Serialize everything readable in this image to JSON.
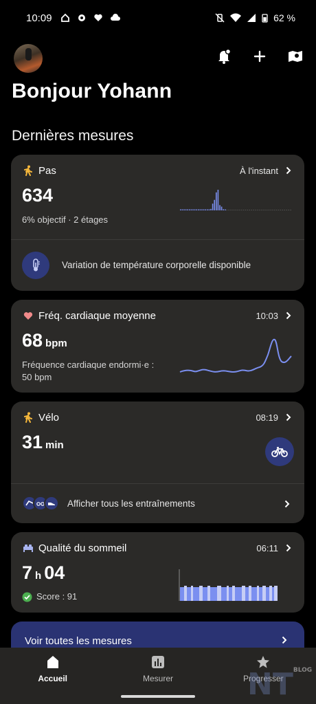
{
  "status_bar": {
    "time": "10:09",
    "battery": "62 %"
  },
  "header": {
    "greeting": "Bonjour Yohann"
  },
  "section_title": "Dernières mesures",
  "cards": {
    "steps": {
      "title": "Pas",
      "time": "À l'instant",
      "value": "634",
      "goal": "6% objectif",
      "floors": "· 2 étages",
      "chart_values": [
        1,
        1,
        1,
        1,
        1,
        1,
        1,
        1,
        1,
        1,
        1,
        1,
        1,
        1,
        1,
        2,
        1,
        4,
        18,
        28,
        48,
        55,
        14,
        10,
        3,
        1
      ]
    },
    "temperature": {
      "text": "Variation de température corporelle disponible"
    },
    "heart": {
      "title": "Fréq. cardiaque moyenne",
      "time": "10:03",
      "value": "68",
      "unit": "bpm",
      "sub1": "Fréquence cardiaque endormi·e :",
      "sub2": "50 bpm"
    },
    "bike": {
      "title": "Vélo",
      "time": "08:19",
      "value": "31",
      "unit": "min",
      "all_workouts": "Afficher tous les entraînements"
    },
    "sleep": {
      "title": "Qualité du sommeil",
      "time": "06:11",
      "hours": "7",
      "h_unit": "h",
      "minutes": "04",
      "score": "Score : 91"
    }
  },
  "see_all": "Voir toutes les mesures",
  "nav": {
    "home": "Accueil",
    "measure": "Mesurer",
    "progress": "Progresser"
  },
  "watermark": {
    "mark": "NT",
    "tag": "BLOG"
  },
  "colors": {
    "accent_blue": "#2f3a7c",
    "line_blue": "#7b8ff0",
    "steps_yellow": "#f5b73b",
    "heart_pink": "#f08a8a"
  }
}
